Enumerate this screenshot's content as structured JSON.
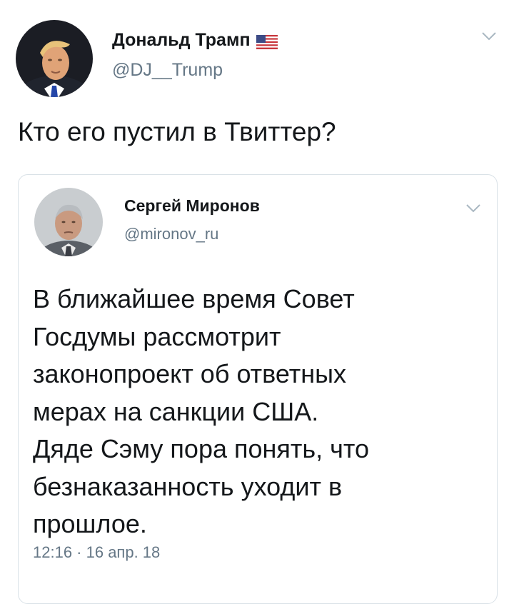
{
  "outer_tweet": {
    "author_name": "Дональд Трамп",
    "author_handle": "@DJ__Trump",
    "avatar_icon": "trump-avatar-photo",
    "flag_icon": "us-flag-emoji",
    "menu_icon": "chevron-down-icon",
    "text": "Кто его пустил в Твиттер?"
  },
  "quoted_tweet": {
    "author_name": "Сергей Миронов",
    "author_handle": "@mironov_ru",
    "avatar_icon": "mironov-avatar-photo",
    "menu_icon": "chevron-down-icon",
    "text_lines": [
      "В ближайшее время Совет",
      "Госдумы рассмотрит",
      "законопроект об ответных",
      "мерах на санкции США.",
      "Дяде Сэму пора понять, что",
      "безнаказанность уходит в",
      "прошлое."
    ],
    "timestamp": "12:16 · 16 апр. 18"
  },
  "colors": {
    "text_primary": "#14171a",
    "text_secondary": "#657786",
    "border": "#d9e1e7",
    "background": "#ffffff"
  }
}
